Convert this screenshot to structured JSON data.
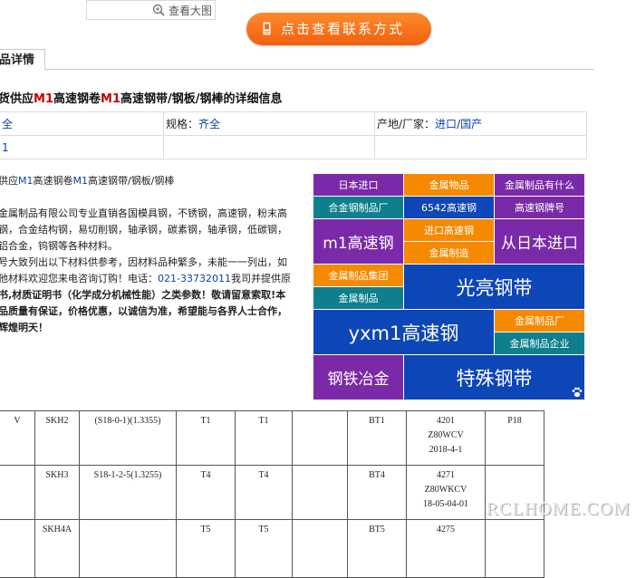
{
  "view_large": "查看大图",
  "contact_button": "点击查看联系方式",
  "tab_label": "品详情",
  "heading": {
    "prefix": "货供应",
    "p1": "M1",
    "mid1": "高速钢卷",
    "p2": "M1",
    "rest": "高速钢带/钢板/钢棒的详细信息"
  },
  "spec": {
    "row1": {
      "col1_value": "全",
      "col2_label": "规格：",
      "col2_value": "齐全",
      "col3_label": "产地/厂家：",
      "col3_v1": "进口",
      "col3_sep": "/",
      "col3_v2": "国产"
    },
    "row2": {
      "col1_value": "1"
    }
  },
  "desc": {
    "line1": {
      "a": "供应",
      "b": "M1",
      "c": "高速钢卷",
      "d": "M1",
      "e": "高速钢带/钢板/钢棒"
    },
    "p2": "金属制品有限公司专业直销各国模具钢，不锈钢，高速钢，粉末高",
    "p3": "钢，合金结构钢，易切削钢，轴承钢，碳素钢，轴承钢，低碳钢，",
    "p4": "铝合金，钨钢等各种材料。",
    "p5": "号大致列出以下材料供参考，因材料品种繁多，未能一一列出，如",
    "p6a": "他材料欢迎您来电咨询订购！电话：",
    "p6b": "021-33732011",
    "p6c": "我司并提供原",
    "p7": "书,材质证明书（化学成分机械性能）之类参数！敬请留意索取!本",
    "p8": "品质量有保证，价格优惠，以诚信为准，希望能与各界人士合作，",
    "p9": "辉煌明天！"
  },
  "tags": [
    {
      "label": "日本进口",
      "color": "#7a2aa8"
    },
    {
      "label": "金属物品",
      "color": "#f58a00"
    },
    {
      "label": "金属制品有什么",
      "color": "#7a2aa8"
    },
    {
      "label": "合金钢制品厂",
      "color": "#0e7f8c"
    },
    {
      "label": "6542高速钢",
      "color": "#0d46b7"
    },
    {
      "label": "高速钢牌号",
      "color": "#7a2aa8"
    },
    {
      "label": "m1高速钢",
      "color": "#7a2aa8"
    },
    {
      "label": "进口高速钢",
      "color": "#f58a00"
    },
    {
      "label": "从日本进口",
      "color": "#7a2aa8"
    },
    {
      "label": "金属制造",
      "color": "#f58a00"
    },
    {
      "label": "金属制品集团",
      "color": "#f58a00"
    },
    {
      "label": "光亮钢带",
      "color": "#0d46b7"
    },
    {
      "label": "金属制品",
      "color": "#0e7f8c"
    },
    {
      "label": "yxm1高速钢",
      "color": "#0d46b7"
    },
    {
      "label": "金属制品厂",
      "color": "#f58a00"
    },
    {
      "label": "金属制品企业",
      "color": "#0e7f8c"
    },
    {
      "label": "钢铁冶金",
      "color": "#7a2aa8"
    },
    {
      "label": "特殊钢带",
      "color": "#0d46b7"
    }
  ],
  "grade_rows": [
    {
      "c0": "V",
      "c1": "SKH2",
      "c2": "(S18-0-1)(1.3355)",
      "c3": "T1",
      "c4": "T1",
      "c5": "",
      "c6": "BT1",
      "c7a": "4201",
      "c7b": "Z80WCV",
      "c7c": "2018-4-1",
      "c8": "P18"
    },
    {
      "c0": "",
      "c1": "SKH3",
      "c2": "S18-1-2-5(1.3255)",
      "c3": "T4",
      "c4": "T4",
      "c5": "",
      "c6": "BT4",
      "c7a": "4271",
      "c7b": "Z80WKCV",
      "c7c": "18-05-04-01",
      "c8": ""
    },
    {
      "c0": "",
      "c1": "SKH4A",
      "c2": "",
      "c3": "T5",
      "c4": "T5",
      "c5": "",
      "c6": "BT5",
      "c7a": "4275",
      "c7b": "",
      "c7c": "",
      "c8": ""
    }
  ],
  "watermark": "RCLHOME.COM"
}
